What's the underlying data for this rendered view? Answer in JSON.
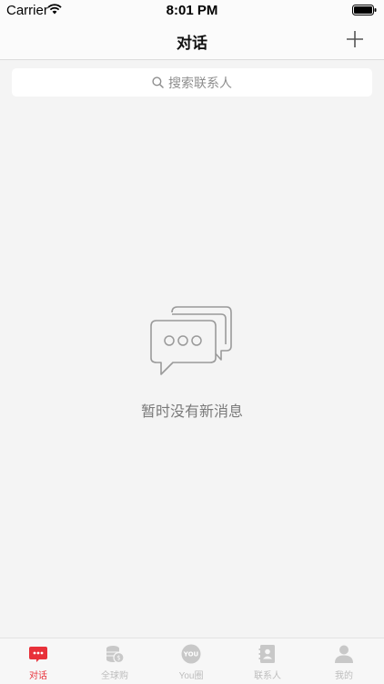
{
  "status_bar": {
    "carrier": "Carrier",
    "time": "8:01 PM"
  },
  "nav": {
    "title": "对话",
    "add_icon": "plus-icon"
  },
  "search": {
    "placeholder": "搜索联系人",
    "icon": "search-icon"
  },
  "empty_state": {
    "icon": "chat-bubbles-icon",
    "message": "暂时没有新消息"
  },
  "tabs": [
    {
      "label": "对话",
      "icon": "chat-icon",
      "active": true
    },
    {
      "label": "全球购",
      "icon": "coins-icon",
      "active": false
    },
    {
      "label": "You圈",
      "icon": "you-circle-icon",
      "badge": "YOU",
      "active": false
    },
    {
      "label": "联系人",
      "icon": "contacts-icon",
      "active": false
    },
    {
      "label": "我的",
      "icon": "profile-icon",
      "active": false
    }
  ],
  "colors": {
    "accent": "#e8313a",
    "inactive": "#bdbdbd",
    "background": "#f4f4f4"
  }
}
